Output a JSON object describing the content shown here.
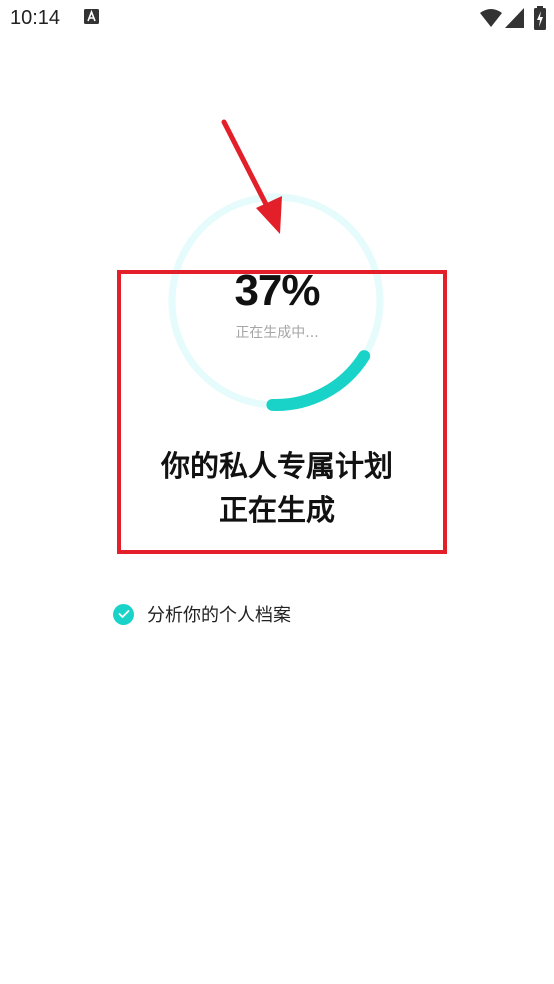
{
  "status_bar": {
    "time": "10:14",
    "notification_icon": "a-notification-icon",
    "wifi_icon": "wifi-icon",
    "signal_icon": "signal-icon",
    "battery_icon": "battery-charging-icon"
  },
  "progress": {
    "percent": 37,
    "value_label": "37%",
    "status_label": "正在生成中...",
    "ring_color": "#19d3c9",
    "track_color": "#e6fbfb"
  },
  "headline": {
    "line1": "你的私人专属计划",
    "line2": "正在生成"
  },
  "checklist": [
    {
      "label": "分析你的个人档案",
      "checked": true
    }
  ],
  "annotations": {
    "arrow_color": "#e3202a",
    "box_color": "#e3202a"
  }
}
